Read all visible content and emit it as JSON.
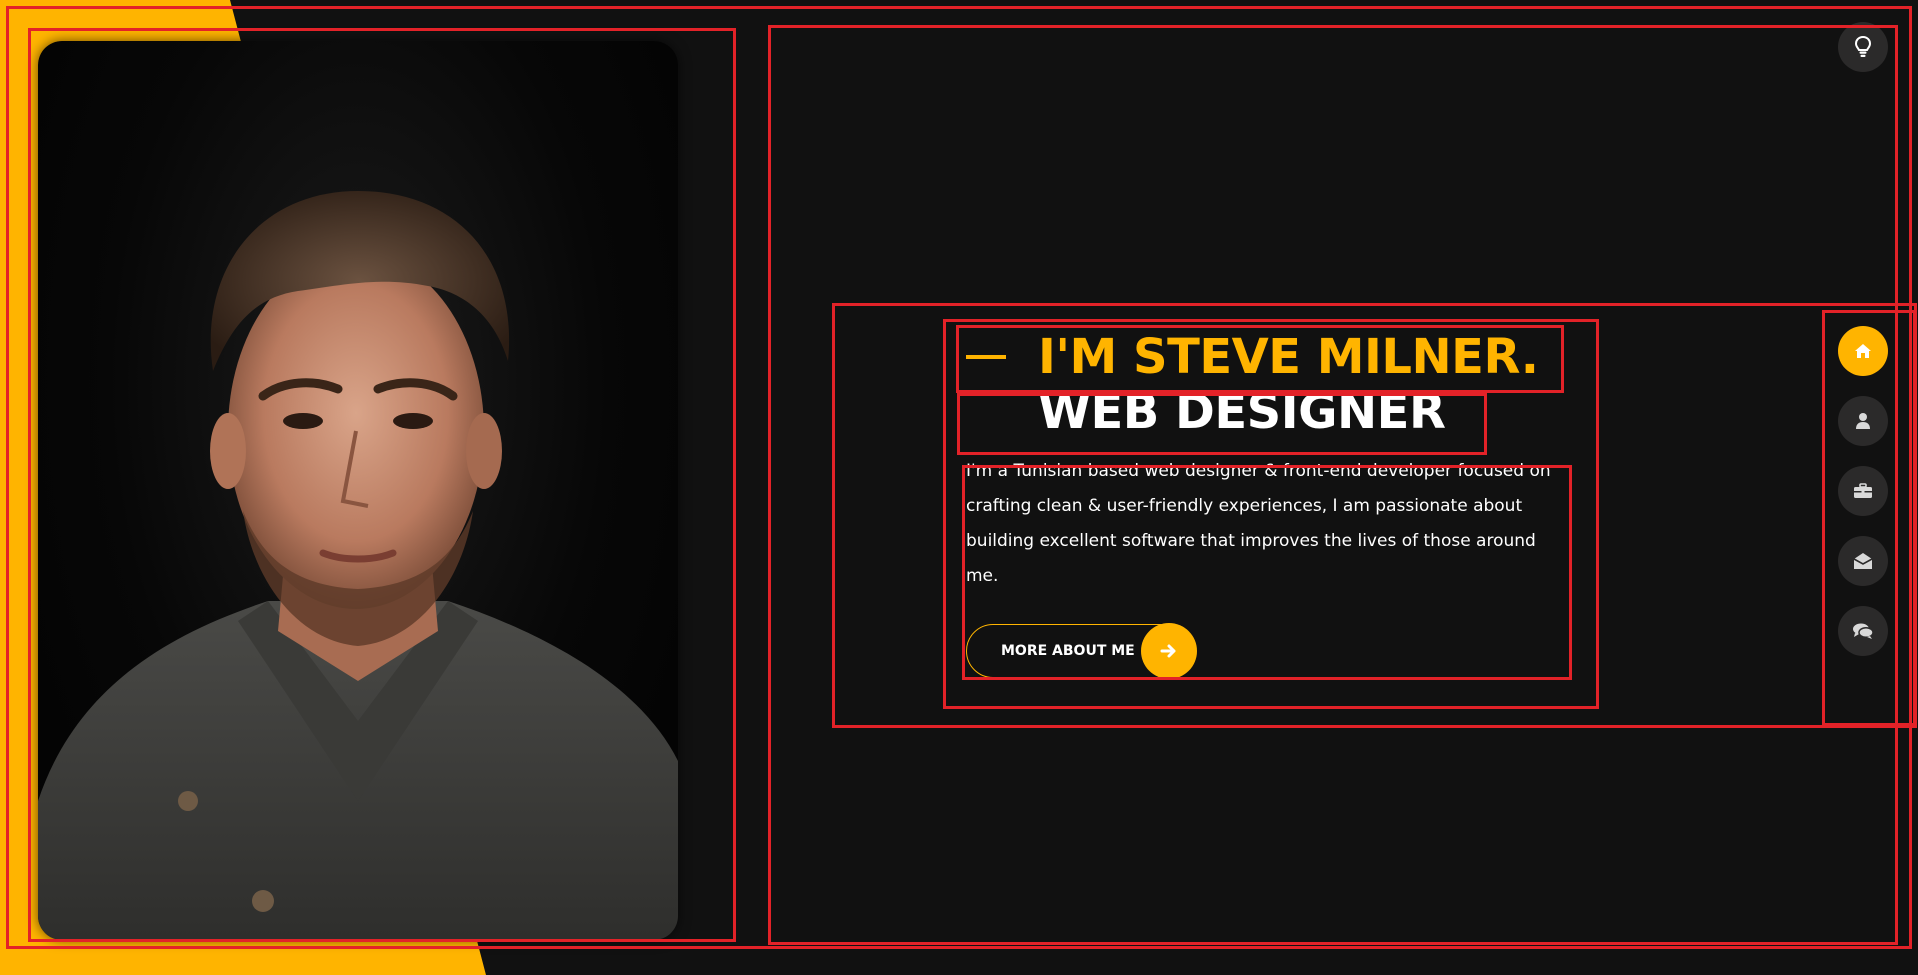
{
  "hero": {
    "title": "I'M STEVE MILNER.",
    "subtitle": "WEB DESIGNER",
    "description": "I'm a Tunisian based web designer & front-end developer focused on crafting clean & user-friendly experiences, I am passionate about building excellent software that improves the lives of those around me.",
    "button_label": "MORE ABOUT ME",
    "button_icon": "arrow-right-icon"
  },
  "nav": {
    "items": [
      {
        "icon": "home-icon",
        "active": true
      },
      {
        "icon": "user-icon",
        "active": false
      },
      {
        "icon": "briefcase-icon",
        "active": false
      },
      {
        "icon": "envelope-open-icon",
        "active": false
      },
      {
        "icon": "comments-icon",
        "active": false
      }
    ]
  },
  "theme_toggle": {
    "icon": "lightbulb-icon"
  },
  "colors": {
    "accent": "#ffb400",
    "background": "#111111",
    "nav_bg": "#2b2a2a",
    "text": "#ffffff",
    "outline": "#e32228"
  }
}
